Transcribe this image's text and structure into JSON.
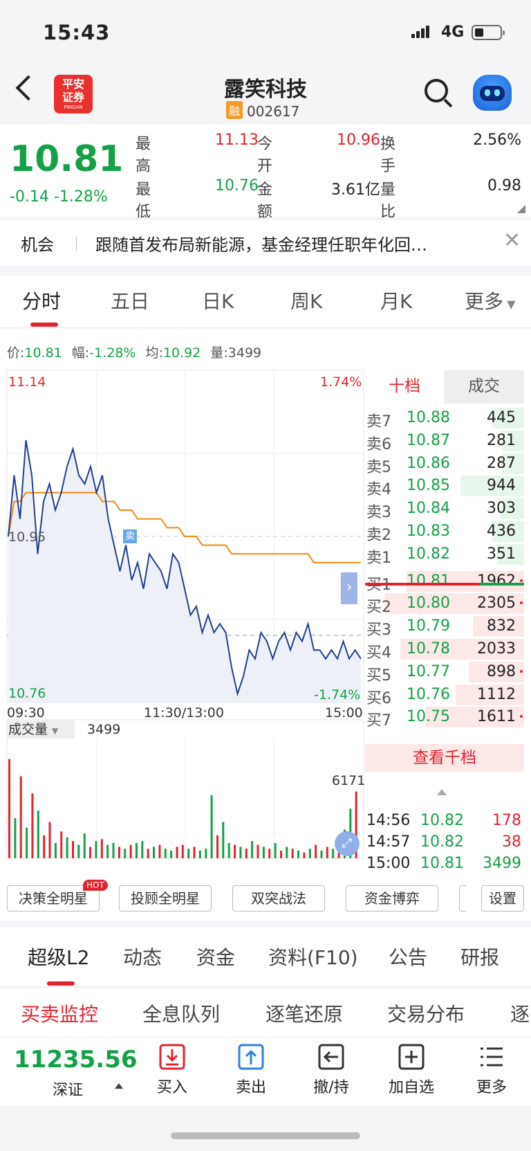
{
  "status_bar": {
    "time": "15:43",
    "network": "4G"
  },
  "header": {
    "broker_logo": "平安证券",
    "broker_logo_sub": "PINGAN",
    "stock_name": "露笑科技",
    "margin_badge": "融",
    "stock_code": "002617"
  },
  "quote": {
    "price": "10.81",
    "change": "-0.14 -1.28%",
    "fields": [
      {
        "label": "最高",
        "value": "11.13",
        "color": "red"
      },
      {
        "label": "今开",
        "value": "10.96",
        "color": "red"
      },
      {
        "label": "换手",
        "value": "2.56%",
        "color": "black"
      },
      {
        "label": "最低",
        "value": "10.76",
        "color": "green"
      },
      {
        "label": "金额",
        "value": "3.61亿",
        "color": "black"
      },
      {
        "label": "量比",
        "value": "0.98",
        "color": "black"
      }
    ]
  },
  "news": {
    "tag": "机会",
    "text": "跟随首发布局新能源，基金经理任职年化回…"
  },
  "chart_tabs": [
    "分时",
    "五日",
    "日K",
    "周K",
    "月K",
    "更多"
  ],
  "chart_info": {
    "price_label": "价:",
    "price": "10.81",
    "range_label": "幅:",
    "range": "-1.28%",
    "avg_label": "均:",
    "avg": "10.92",
    "vol_label": "量:",
    "vol": "3499"
  },
  "chart_labels": {
    "y_top": "11.14",
    "y_mid": "10.95",
    "y_bottom": "10.76",
    "pct_top": "1.74%",
    "pct_bottom": "-1.74%",
    "x_start": "09:30",
    "x_mid": "11:30/13:00",
    "x_end": "15:00",
    "sell_marker": "卖",
    "volume_selector": "成交量",
    "volume_value": "3499",
    "volume_max": "6171"
  },
  "chart_data": {
    "type": "line",
    "x_ticks": [
      "09:30",
      "11:30/13:00",
      "15:00"
    ],
    "ylim": [
      10.76,
      11.14
    ],
    "prev_close": 10.95,
    "series": [
      {
        "name": "价",
        "values": [
          10.95,
          11.02,
          10.97,
          11.06,
          11.02,
          10.93,
          10.99,
          11.01,
          10.98,
          11.0,
          11.03,
          11.05,
          11.02,
          11.01,
          11.03,
          11.0,
          11.02,
          10.97,
          10.94,
          10.91,
          10.94,
          10.9,
          10.92,
          10.89,
          10.93,
          10.92,
          10.91,
          10.89,
          10.93,
          10.92,
          10.89,
          10.86,
          10.87,
          10.84,
          10.86,
          10.84,
          10.85,
          10.84,
          10.8,
          10.77,
          10.79,
          10.82,
          10.81,
          10.84,
          10.83,
          10.81,
          10.83,
          10.84,
          10.82,
          10.84,
          10.83,
          10.85,
          10.82,
          10.82,
          10.81,
          10.82,
          10.81,
          10.83,
          10.81,
          10.82,
          10.81
        ]
      },
      {
        "name": "均",
        "values": [
          10.95,
          10.99,
          10.99,
          11.0,
          11.0,
          11.0,
          11.0,
          11.0,
          11.0,
          11.0,
          11.0,
          11.0,
          11.0,
          11.0,
          11.0,
          11.0,
          10.99,
          10.99,
          10.99,
          10.98,
          10.98,
          10.98,
          10.97,
          10.97,
          10.97,
          10.97,
          10.97,
          10.96,
          10.96,
          10.96,
          10.95,
          10.95,
          10.95,
          10.94,
          10.94,
          10.94,
          10.94,
          10.94,
          10.93,
          10.93,
          10.93,
          10.93,
          10.93,
          10.93,
          10.93,
          10.93,
          10.93,
          10.93,
          10.93,
          10.93,
          10.93,
          10.93,
          10.92,
          10.92,
          10.92,
          10.92,
          10.92,
          10.92,
          10.92,
          10.92,
          10.92
        ]
      }
    ],
    "volume": {
      "max": 6171,
      "values": [
        5200,
        2100,
        4300,
        1600,
        3400,
        2500,
        1200,
        1900,
        800,
        1400,
        1100,
        900,
        700,
        1300,
        600,
        900,
        1000,
        700,
        800,
        600,
        500,
        700,
        800,
        900,
        500,
        600,
        700,
        500,
        400,
        600,
        700,
        500,
        600,
        400,
        500,
        3300,
        1200,
        1900,
        800,
        700,
        600,
        500,
        900,
        700,
        600,
        500,
        800,
        400,
        600,
        500,
        400,
        300,
        500,
        700,
        400,
        600,
        500,
        800,
        1500,
        2600,
        3499
      ],
      "colors": [
        "r",
        "g",
        "r",
        "g",
        "r",
        "g",
        "r",
        "r",
        "g",
        "r",
        "g",
        "r",
        "g",
        "g",
        "r",
        "g",
        "r",
        "g",
        "g",
        "r",
        "g",
        "r",
        "g",
        "g",
        "r",
        "g",
        "r",
        "g",
        "g",
        "r",
        "r",
        "g",
        "r",
        "g",
        "g",
        "g",
        "r",
        "g",
        "g",
        "r",
        "g",
        "r",
        "g",
        "r",
        "g",
        "r",
        "g",
        "r",
        "g",
        "r",
        "g",
        "r",
        "g",
        "r",
        "g",
        "r",
        "g",
        "r",
        "g",
        "g",
        "r"
      ]
    }
  },
  "order_book": {
    "tabs": [
      "十档",
      "成交"
    ],
    "sells": [
      {
        "label": "卖7",
        "price": "10.88",
        "vol": "445",
        "ratio": 0.2
      },
      {
        "label": "卖6",
        "price": "10.87",
        "vol": "281",
        "ratio": 0.14
      },
      {
        "label": "卖5",
        "price": "10.86",
        "vol": "287",
        "ratio": 0.14
      },
      {
        "label": "卖4",
        "price": "10.85",
        "vol": "944",
        "ratio": 0.4
      },
      {
        "label": "卖3",
        "price": "10.84",
        "vol": "303",
        "ratio": 0.15
      },
      {
        "label": "卖2",
        "price": "10.83",
        "vol": "436",
        "ratio": 0.2
      },
      {
        "label": "卖1",
        "price": "10.82",
        "vol": "351",
        "ratio": 0.17
      }
    ],
    "buys": [
      {
        "label": "买1",
        "price": "10.81",
        "vol": "1962",
        "ratio": 0.74,
        "dot": true
      },
      {
        "label": "买2",
        "price": "10.80",
        "vol": "2305",
        "ratio": 0.88,
        "dot": true
      },
      {
        "label": "买3",
        "price": "10.79",
        "vol": "832",
        "ratio": 0.32,
        "dot": false
      },
      {
        "label": "买4",
        "price": "10.78",
        "vol": "2033",
        "ratio": 0.78,
        "dot": false
      },
      {
        "label": "买5",
        "price": "10.77",
        "vol": "898",
        "ratio": 0.35,
        "dot": true
      },
      {
        "label": "买6",
        "price": "10.76",
        "vol": "1112",
        "ratio": 0.43,
        "dot": false
      },
      {
        "label": "买7",
        "price": "10.75",
        "vol": "1611",
        "ratio": 0.62,
        "dot": true
      }
    ],
    "more_button": "查看千档",
    "trades": [
      {
        "time": "14:56",
        "price": "10.82",
        "vol": "178",
        "vol_color": "red"
      },
      {
        "time": "14:57",
        "price": "10.82",
        "vol": "38",
        "vol_color": "red"
      },
      {
        "time": "15:00",
        "price": "10.81",
        "vol": "3499",
        "vol_color": "green"
      }
    ]
  },
  "strategies": {
    "hot_badge": "HOT",
    "items": [
      "决策全明星",
      "投顾全明星",
      "双突战法",
      "资金博弈"
    ],
    "settings": "设置"
  },
  "section_tabs": [
    "超级L2",
    "动态",
    "资金",
    "资料(F10)",
    "公告",
    "研报"
  ],
  "sub_tabs": [
    "买卖监控",
    "全息队列",
    "逐笔还原",
    "交易分布",
    "逐"
  ],
  "toolbar": {
    "index_value": "11235.56",
    "index_name": "深证",
    "buy": "买入",
    "sell": "卖出",
    "cancel": "撤/持",
    "watch": "加自选",
    "more": "更多"
  },
  "colors": {
    "red": "#e0242f",
    "green": "#14a047",
    "price_line": "#1f3f8f",
    "avg_line": "#f08a12"
  }
}
